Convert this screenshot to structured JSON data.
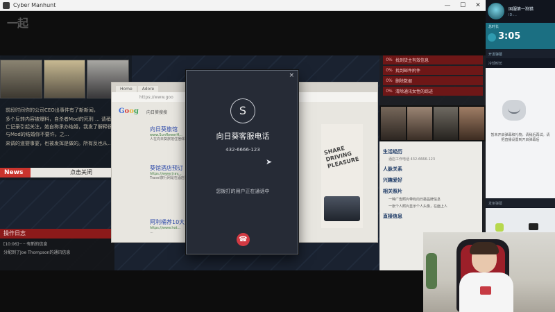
{
  "window": {
    "title": "Cyber Manhunt",
    "controls": [
      "—",
      "☐",
      "✕"
    ],
    "logo_text": "一起"
  },
  "game": {
    "news": {
      "paragraphs": [
        "前段时间你的公司CEO出事件有了新新闻，",
        "多个反转内容被爆料，自杀者Mod的死刑 ... 请稍的死亡记录引起关注，她自称承办结婚，我发了解释很明，与Mod的结婚你不要许。之...",
        "来调的道婴事宴，也被发挥是做的。所有反也从..."
      ],
      "tag": "News",
      "close_label": "点击关闭"
    },
    "log": {
      "header": "操作日志",
      "lines": [
        "[10:06]······有新的信息",
        "分配到了Joe Thompson的通讯信息"
      ]
    },
    "browser": {
      "tabs": [
        "Home",
        "Adore"
      ],
      "address": "https://www.goo",
      "logo": [
        "G",
        "o",
        "o",
        "g"
      ],
      "query": "向日葵搜搜",
      "results": [
        {
          "title": "向日葵旅馆",
          "url": "www.SunflowerH...",
          "desc": "人在向日葵旅馆住宿体验优惠服务，以便能够提供更好的..."
        },
        {
          "title": "葵馆酒店预订",
          "url": "https://www.trav...",
          "desc": "Travel旅行网是在酒店预订平台，酒店点评及网站上的..."
        },
        {
          "title": "阿利桶荐10大",
          "url": "https://www.hot...",
          "desc": "..."
        }
      ],
      "ad_text": "SHARE DRIVING PLEASURE"
    },
    "tasks": [
      {
        "pct": "0%",
        "label": "找到货主有效信息"
      },
      {
        "pct": "0%",
        "label": "找到邮件附件"
      },
      {
        "pct": "0%",
        "label": "删除数据"
      },
      {
        "pct": "0%",
        "label": "清除通讯女性的踪迹"
      }
    ],
    "profile": {
      "sections": [
        {
          "head": "生活经历",
          "items": [
            "酒店工作电话 432-6666-123"
          ]
        },
        {
          "head": "人脉关系",
          "items": []
        },
        {
          "head": "兴趣爱好",
          "items": []
        },
        {
          "head": "相关照片",
          "items": [
            "一种广告照片带有向日葵品牌信息",
            "一张个人照片显示个人头像，在面上人"
          ]
        },
        {
          "head": "直接信息",
          "items": []
        }
      ]
    }
  },
  "call": {
    "avatar_letter": "S",
    "caller_name": "向日葵客服电话",
    "number": "432-6666-123",
    "status": "您拨打的用户正在通话中",
    "close_symbol": "×",
    "hangup_symbol": "☎"
  },
  "stream": {
    "streamer_name": "国服第一狩猎",
    "streamer_id": "ID:...",
    "timer_head": "总时长",
    "timer": "3:05",
    "timer_sub": "",
    "chat_tab": "开发弹幕",
    "chat_sub": "冷却时长",
    "chat_empty": "暂未开启弹幕和礼物，请稍后再试。请把直播设置到开启弹幕后",
    "input_placeholder": "发条弹幕"
  },
  "colors": {
    "accent_red": "#c9342d",
    "modal_bg": "#262b36",
    "hangup": "#d23a43",
    "timer_bg": "#1b6f82"
  }
}
